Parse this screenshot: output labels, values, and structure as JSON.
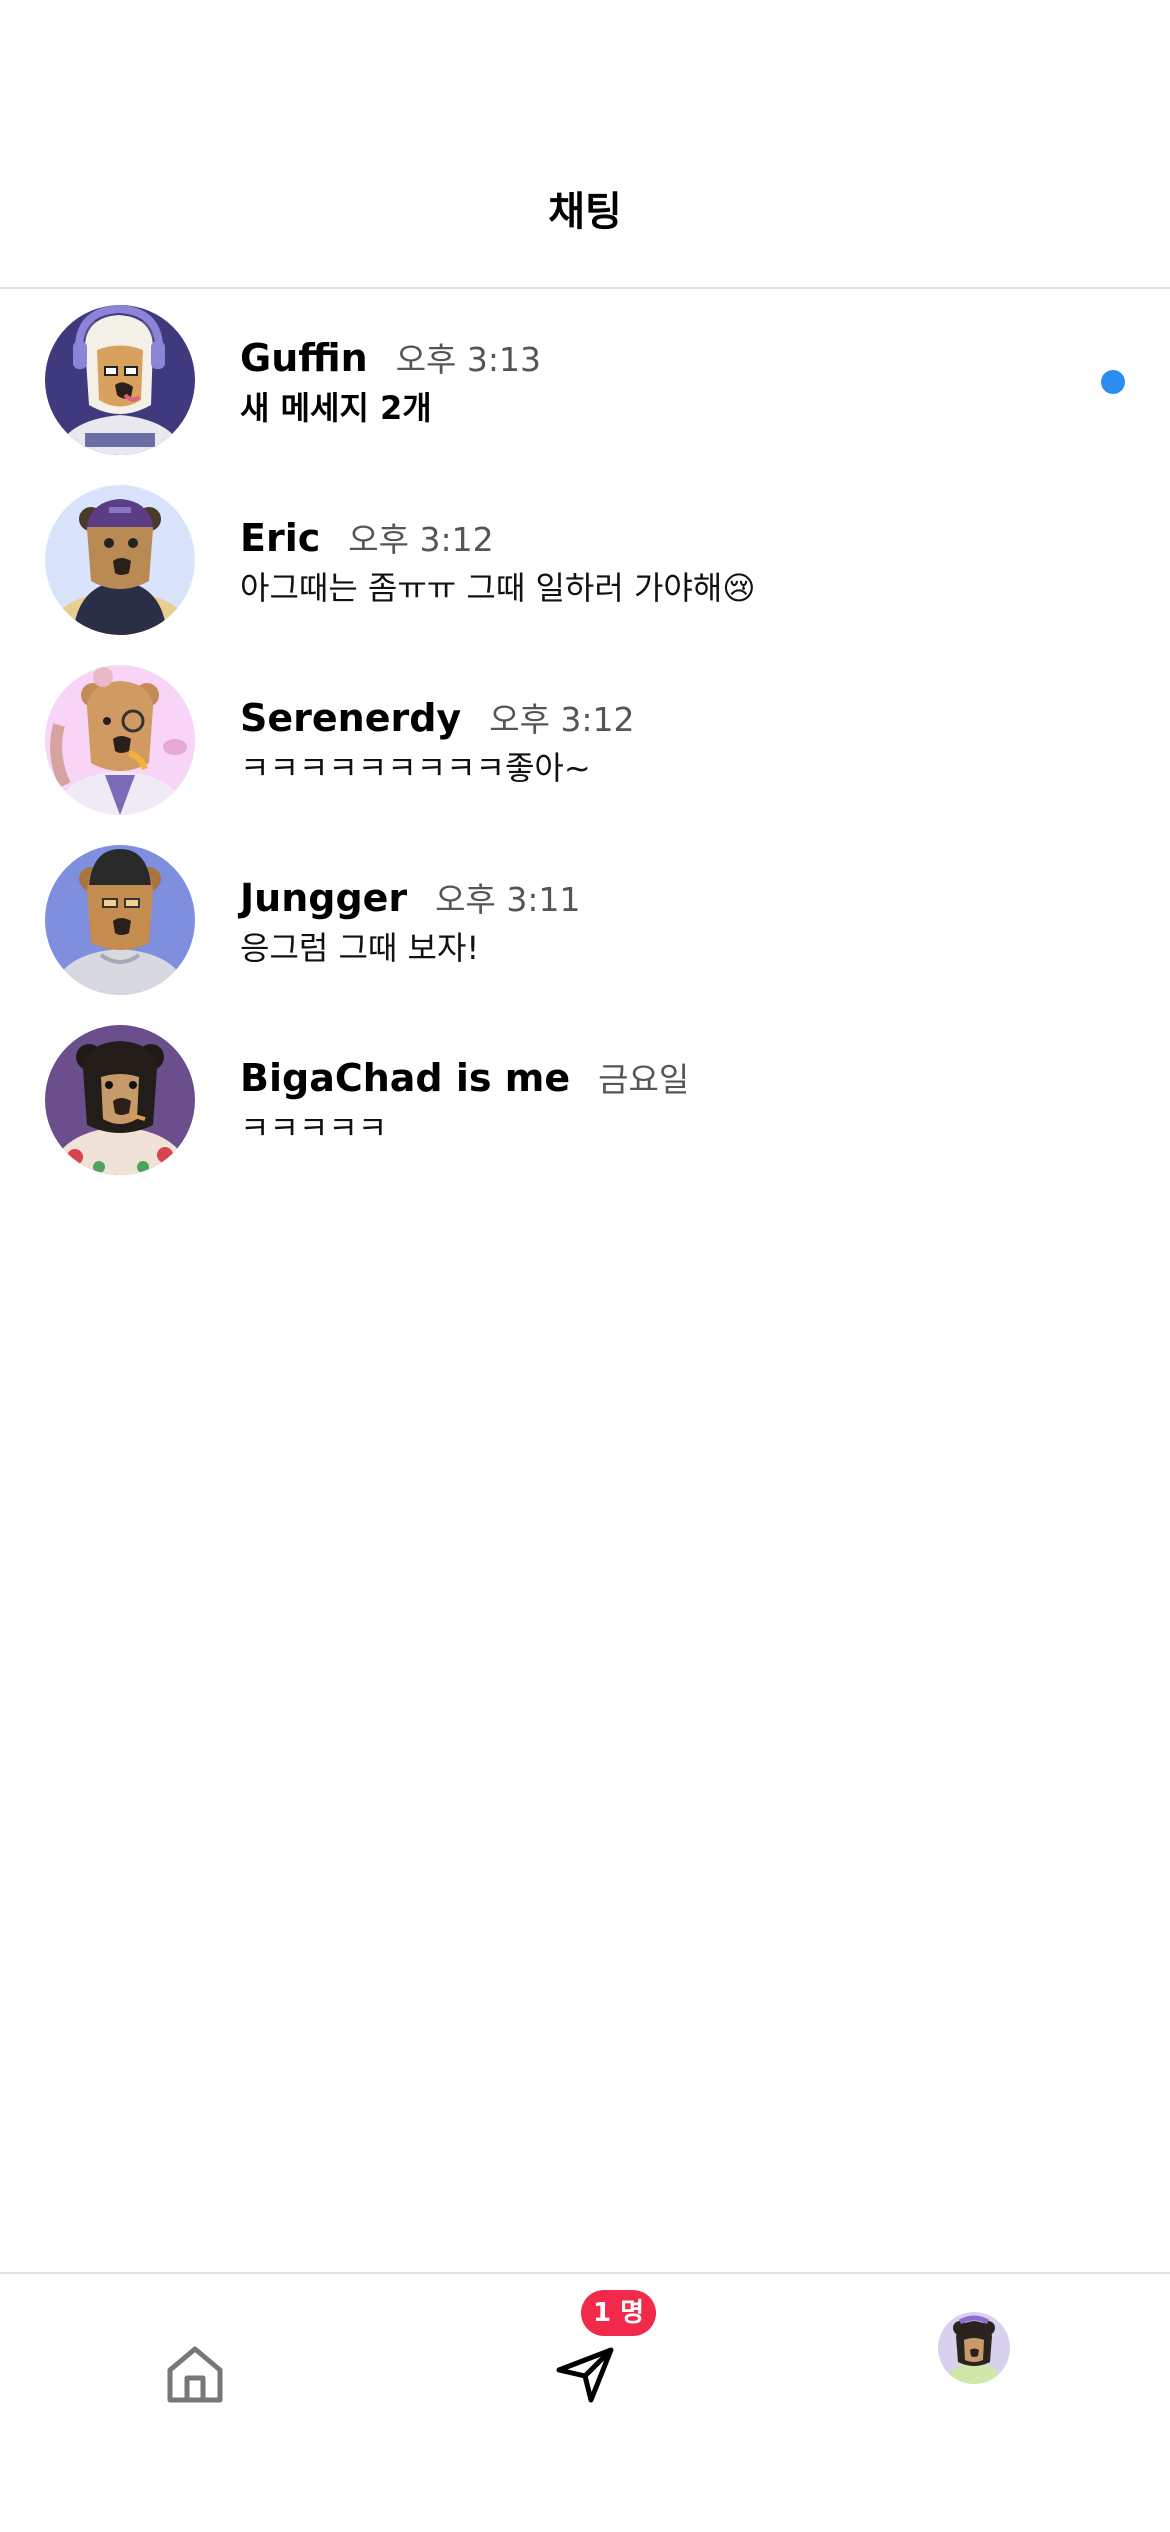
{
  "header": {
    "title": "채팅"
  },
  "chats": [
    {
      "name": "Guffin",
      "time": "오후 3:13",
      "preview": "새 메세지 2개",
      "unread": true,
      "avatar_bg": "#3f3a7e",
      "avatar_icon": "bear-headphones-avatar"
    },
    {
      "name": "Eric",
      "time": "오후 3:12",
      "preview": "아그때는 좀ㅠㅠ 그때 일하러 가야해😢",
      "unread": false,
      "avatar_bg": "#d9e3fb",
      "avatar_icon": "bear-purple-cap-avatar"
    },
    {
      "name": "Serenerdy",
      "time": "오후 3:12",
      "preview": "ㅋㅋㅋㅋㅋㅋㅋㅋㅋ좋아~",
      "unread": false,
      "avatar_bg": "#f8d4f6",
      "avatar_icon": "bear-monocle-avatar"
    },
    {
      "name": "Jungger",
      "time": "오후 3:11",
      "preview": "응그럼 그때 보자!",
      "unread": false,
      "avatar_bg": "#7f8fe0",
      "avatar_icon": "bear-beanie-avatar"
    },
    {
      "name": "BigaChad is me",
      "time": "금요일",
      "preview": "ㅋㅋㅋㅋㅋ",
      "unread": false,
      "avatar_bg": "#6b4e8c",
      "avatar_icon": "black-bear-floral-avatar"
    }
  ],
  "tab_bar": {
    "items": [
      "home-icon",
      "send-icon",
      "profile-avatar"
    ],
    "dm_badge": "1 명"
  },
  "colors": {
    "unread_dot": "#2d8cf0",
    "badge": "#f2294b",
    "divider": "#e3e3e3"
  }
}
